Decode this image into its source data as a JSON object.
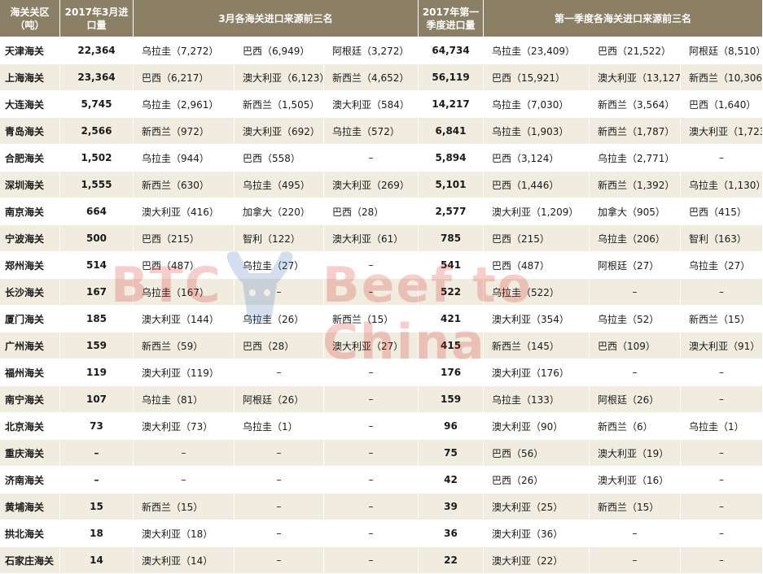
{
  "header": {
    "col_customs": "海关关区（吨）",
    "col_march": "2017年3月进口量",
    "col_march_top3": "3月各海关进口来源前三名",
    "col_q1": "2017年第一季度进口量",
    "col_q1_top3": "第一季度各海关进口来源前三名"
  },
  "rows": [
    {
      "name": "天津海关",
      "march": "22,364",
      "m1": "乌拉圭（7,272）",
      "m2": "巴西（6,949）",
      "m3": "阿根廷（3,272）",
      "q1": "64,734",
      "q1a": "乌拉圭（23,409）",
      "q1b": "巴西（21,522）",
      "q1c": "阿根廷（8,510）"
    },
    {
      "name": "上海海关",
      "march": "23,364",
      "m1": "巴西（6,217）",
      "m2": "澳大利亚（6,123）",
      "m3": "新西兰（4,652）",
      "q1": "56,119",
      "q1a": "巴西（15,921）",
      "q1b": "澳大利亚（13,127）",
      "q1c": "新西兰（10,306）"
    },
    {
      "name": "大连海关",
      "march": "5,745",
      "m1": "乌拉圭（2,961）",
      "m2": "新西兰（1,505）",
      "m3": "澳大利亚（584）",
      "q1": "14,217",
      "q1a": "乌拉圭（7,030）",
      "q1b": "新西兰（3,564）",
      "q1c": "巴西（1,640）"
    },
    {
      "name": "青岛海关",
      "march": "2,566",
      "m1": "新西兰（972）",
      "m2": "澳大利亚（692）",
      "m3": "乌拉圭（572）",
      "q1": "6,841",
      "q1a": "乌拉圭（1,903）",
      "q1b": "新西兰（1,787）",
      "q1c": "澳大利亚（1,723）"
    },
    {
      "name": "合肥海关",
      "march": "1,502",
      "m1": "乌拉圭（944）",
      "m2": "巴西（558）",
      "m3": "–",
      "q1": "5,894",
      "q1a": "巴西（3,124）",
      "q1b": "乌拉圭（2,771）",
      "q1c": "–"
    },
    {
      "name": "深圳海关",
      "march": "1,555",
      "m1": "新西兰（630）",
      "m2": "乌拉圭（495）",
      "m3": "澳大利亚（269）",
      "q1": "5,101",
      "q1a": "巴西（1,446）",
      "q1b": "新西兰（1,392）",
      "q1c": "乌拉圭（1,130）"
    },
    {
      "name": "南京海关",
      "march": "664",
      "m1": "澳大利亚（416）",
      "m2": "加拿大（220）",
      "m3": "巴西（28）",
      "q1": "2,577",
      "q1a": "澳大利亚（1,209）",
      "q1b": "加拿大（905）",
      "q1c": "巴西（415）"
    },
    {
      "name": "宁波海关",
      "march": "500",
      "m1": "巴西（215）",
      "m2": "智利（122）",
      "m3": "澳大利亚（61）",
      "q1": "785",
      "q1a": "巴西（215）",
      "q1b": "乌拉圭（206）",
      "q1c": "智利（163）"
    },
    {
      "name": "郑州海关",
      "march": "514",
      "m1": "巴西（487）",
      "m2": "乌拉圭（27）",
      "m3": "–",
      "q1": "541",
      "q1a": "巴西（487）",
      "q1b": "阿根廷（27）",
      "q1c": "乌拉圭（27）"
    },
    {
      "name": "长沙海关",
      "march": "167",
      "m1": "乌拉圭（167）",
      "m2": "–",
      "m3": "–",
      "q1": "522",
      "q1a": "乌拉圭（522）",
      "q1b": "–",
      "q1c": "–"
    },
    {
      "name": "厦门海关",
      "march": "185",
      "m1": "澳大利亚（144）",
      "m2": "乌拉圭（26）",
      "m3": "新西兰（15）",
      "q1": "421",
      "q1a": "澳大利亚（354）",
      "q1b": "乌拉圭（52）",
      "q1c": "新西兰（15）"
    },
    {
      "name": "广州海关",
      "march": "159",
      "m1": "新西兰（59）",
      "m2": "巴西（28）",
      "m3": "澳大利亚（27）",
      "q1": "415",
      "q1a": "新西兰（145）",
      "q1b": "巴西（109）",
      "q1c": "澳大利亚（91）"
    },
    {
      "name": "福州海关",
      "march": "119",
      "m1": "澳大利亚（119）",
      "m2": "–",
      "m3": "–",
      "q1": "176",
      "q1a": "澳大利亚（176）",
      "q1b": "–",
      "q1c": "–"
    },
    {
      "name": "南宁海关",
      "march": "107",
      "m1": "乌拉圭（81）",
      "m2": "阿根廷（26）",
      "m3": "–",
      "q1": "159",
      "q1a": "乌拉圭（133）",
      "q1b": "阿根廷（26）",
      "q1c": "–"
    },
    {
      "name": "北京海关",
      "march": "73",
      "m1": "澳大利亚（73）",
      "m2": "乌拉圭（1）",
      "m3": "–",
      "q1": "96",
      "q1a": "澳大利亚（90）",
      "q1b": "新西兰（6）",
      "q1c": "乌拉圭（1）"
    },
    {
      "name": "重庆海关",
      "march": "–",
      "m1": "–",
      "m2": "–",
      "m3": "–",
      "q1": "75",
      "q1a": "巴西（56）",
      "q1b": "澳大利亚（19）",
      "q1c": "–"
    },
    {
      "name": "济南海关",
      "march": "–",
      "m1": "–",
      "m2": "–",
      "m3": "–",
      "q1": "42",
      "q1a": "巴西（26）",
      "q1b": "澳大利亚（16）",
      "q1c": "–"
    },
    {
      "name": "黄埔海关",
      "march": "15",
      "m1": "新西兰（15）",
      "m2": "–",
      "m3": "–",
      "q1": "39",
      "q1a": "澳大利亚（25）",
      "q1b": "新西兰（15）",
      "q1c": "–"
    },
    {
      "name": "拱北海关",
      "march": "18",
      "m1": "澳大利亚（18）",
      "m2": "–",
      "m3": "–",
      "q1": "36",
      "q1a": "澳大利亚（36）",
      "q1b": "–",
      "q1c": "–"
    },
    {
      "name": "石家庄海关",
      "march": "14",
      "m1": "澳大利亚（14）",
      "m2": "–",
      "m3": "–",
      "q1": "22",
      "q1a": "澳大利亚（22）",
      "q1b": "–",
      "q1c": "–"
    }
  ],
  "watermark": {
    "text_left": "BTC",
    "text_right": "Beef to China",
    "color": "#d9251c",
    "icon": "bull-head-logo-icon"
  },
  "colors": {
    "header_bg": "#8b7f65",
    "stripe_bg": "#f0ece0"
  }
}
